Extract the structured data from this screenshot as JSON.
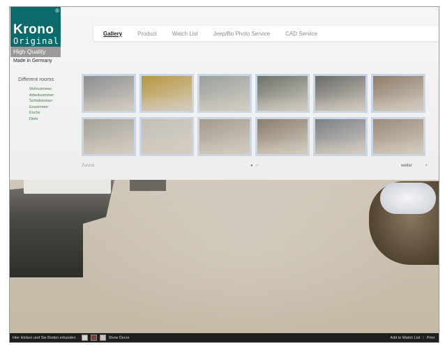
{
  "logo": {
    "reg_mark": "®",
    "line1": "Krono",
    "line2": "Original",
    "quality": "High Quality",
    "made": "Made in Germany"
  },
  "nav": {
    "tabs": [
      "Gallery",
      "Product",
      "Watch List",
      "Jeep/Bo Photo Service",
      "CAD Service"
    ],
    "active_index": 0
  },
  "sidebar": {
    "title": "Different rooms",
    "items": [
      "Wohnzimmer",
      "Arbeitszimmer",
      "Schlafzimmer",
      "Esszimmer",
      "Küche",
      "Diele"
    ]
  },
  "gallery": {
    "thumb_colors": [
      [
        "#8e8e90",
        "#b89640",
        "#9aa09c",
        "#6d7268",
        "#6a6a66",
        "#8e7c6a"
      ],
      [
        "#a8a39a",
        "#c4bfb6",
        "#a49a8c",
        "#8a7d6c",
        "#7c7f84",
        "#9a8a78"
      ]
    ],
    "prev_label": "Zurück",
    "page_indicator": "● ○",
    "next_label": "weiter",
    "next_arrow": "›"
  },
  "bottom_bar": {
    "floor_text": "Hier klicken und Sie Boden erkunden",
    "swatch_colors": [
      "#d9d3c8",
      "#7a4030",
      "#c9c2b5"
    ],
    "change_label": "Show Decor",
    "watchlist_label": "Add to Watch List",
    "print_label": "Print"
  },
  "colors": {
    "logo_teal": "#0d6a6a",
    "thumb_border": "#c9d6e6"
  }
}
